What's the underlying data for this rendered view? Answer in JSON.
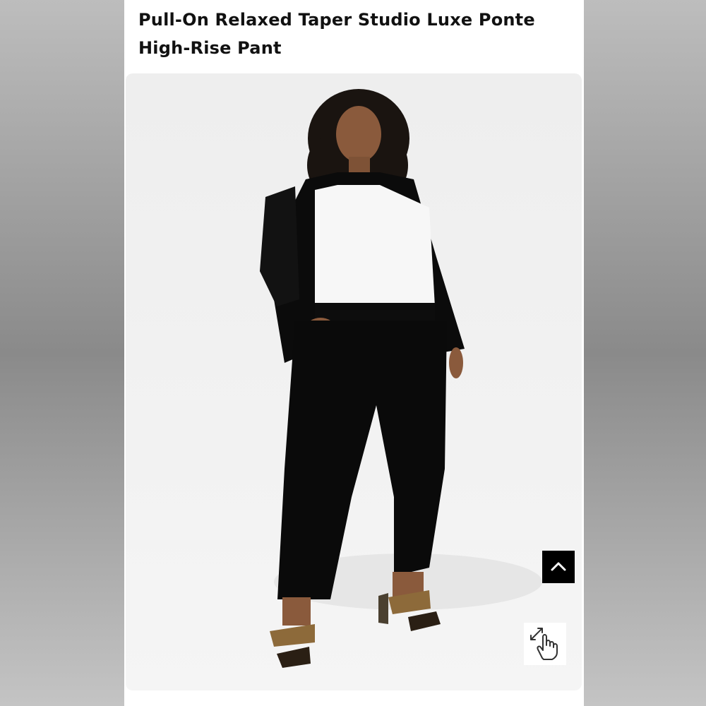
{
  "product": {
    "title_line1": "Pull-On Relaxed Taper Studio Luxe Ponte",
    "title_line2": "High-Rise Pant"
  },
  "image": {
    "icon": "product-photo"
  },
  "controls": {
    "back_to_top_icon": "chevron-up-icon",
    "zoom_hint_icon": "pinch-zoom-hand-icon"
  },
  "colors": {
    "title": "#111111",
    "button_bg": "#000000",
    "page_bg": "#ffffff",
    "image_bg": "#efefef"
  }
}
